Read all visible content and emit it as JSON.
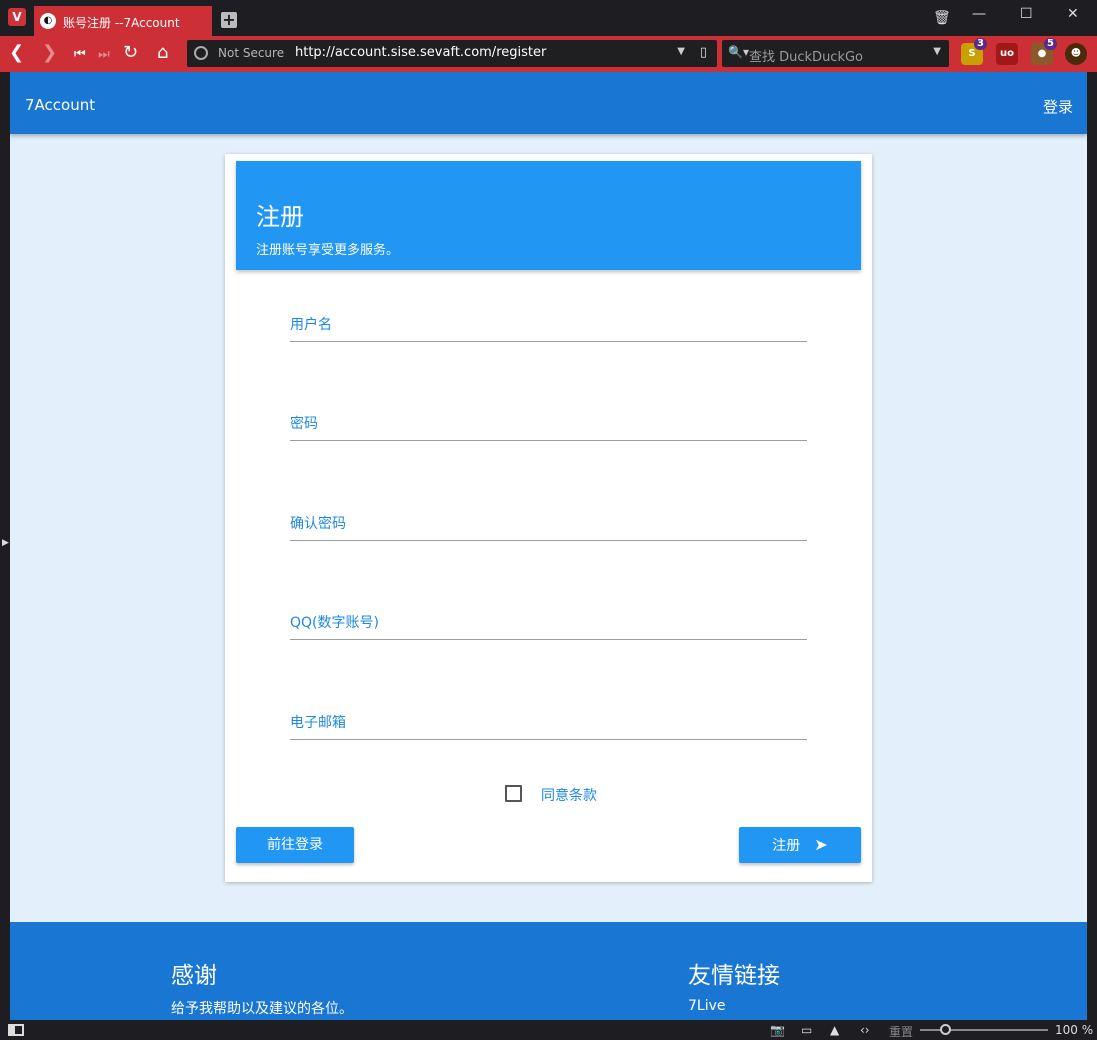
{
  "browser": {
    "tab_title": "账号注册 --7Account",
    "url_security": "Not Secure",
    "url": "http://account.sise.sevaft.com/register",
    "search_placeholder": "查找 DuckDuckGo",
    "extensions": [
      {
        "name": "stylish-extension-icon",
        "badge": "3",
        "color": "#c8a000"
      },
      {
        "name": "ublock-origin-icon",
        "badge": "",
        "color": "#a01818"
      },
      {
        "name": "cookie-extension-icon",
        "badge": "5",
        "color": "#8a5a2a"
      },
      {
        "name": "avatar-extension-icon",
        "badge": "",
        "color": "#4a2a0a"
      }
    ],
    "status": {
      "reset_label": "重置",
      "zoom": "100 %"
    }
  },
  "appbar": {
    "brand": "7Account",
    "login_link": "登录"
  },
  "card": {
    "title": "注册",
    "subtitle": "注册账号享受更多服务。",
    "fields": {
      "username": "用户名",
      "password": "密码",
      "confirm_password": "确认密码",
      "qq": "QQ(数字账号)",
      "email": "电子邮箱"
    },
    "agree_terms": "同意条款",
    "agree_checked": false,
    "go_login_button": "前往登录",
    "register_button": "注册"
  },
  "footer": {
    "thanks_title": "感谢",
    "thanks_text": "给予我帮助以及建议的各位。",
    "links_title": "友情链接",
    "links_first": "7Live"
  }
}
